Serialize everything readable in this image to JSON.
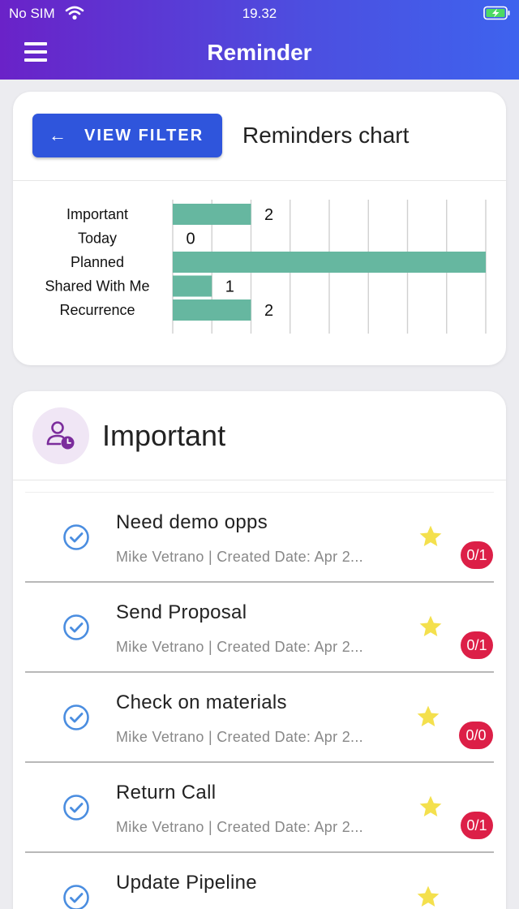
{
  "status_bar": {
    "carrier": "No SIM",
    "time": "19.32"
  },
  "header": {
    "title": "Reminder"
  },
  "filter_button": {
    "label": "VIEW FILTER"
  },
  "chart_card": {
    "title": "Reminders chart"
  },
  "chart_data": {
    "type": "bar",
    "orientation": "horizontal",
    "categories": [
      "Important",
      "Today",
      "Planned",
      "Shared With Me",
      "Recurrence"
    ],
    "values": [
      2,
      0,
      8,
      1,
      2
    ],
    "data_labels": [
      "2",
      "0",
      "",
      "1",
      "2"
    ],
    "xlim": [
      0,
      8
    ],
    "grid": true,
    "bar_color": "#66b7a0"
  },
  "important": {
    "title": "Important",
    "items": [
      {
        "title": "Need demo opps",
        "subtitle": "Mike Vetrano | Created Date: Apr 2...",
        "badge": "0/1"
      },
      {
        "title": "Send Proposal",
        "subtitle": "Mike Vetrano | Created Date: Apr 2...",
        "badge": "0/1"
      },
      {
        "title": "Check on materials",
        "subtitle": "Mike Vetrano | Created Date: Apr 2...",
        "badge": "0/0"
      },
      {
        "title": "Return Call",
        "subtitle": "Mike Vetrano | Created Date: Apr 2...",
        "badge": "0/1"
      },
      {
        "title": "Update Pipeline",
        "subtitle": "",
        "badge": ""
      }
    ]
  },
  "colors": {
    "accent": "#2f55dc",
    "badge": "#dc1f47",
    "star": "#f4e04d",
    "check": "#4a8de0"
  },
  "icons": {
    "menu": "hamburger-icon",
    "back": "arrow-left-icon",
    "important": "user-clock-icon",
    "check": "check-circle-icon",
    "star": "star-icon"
  }
}
